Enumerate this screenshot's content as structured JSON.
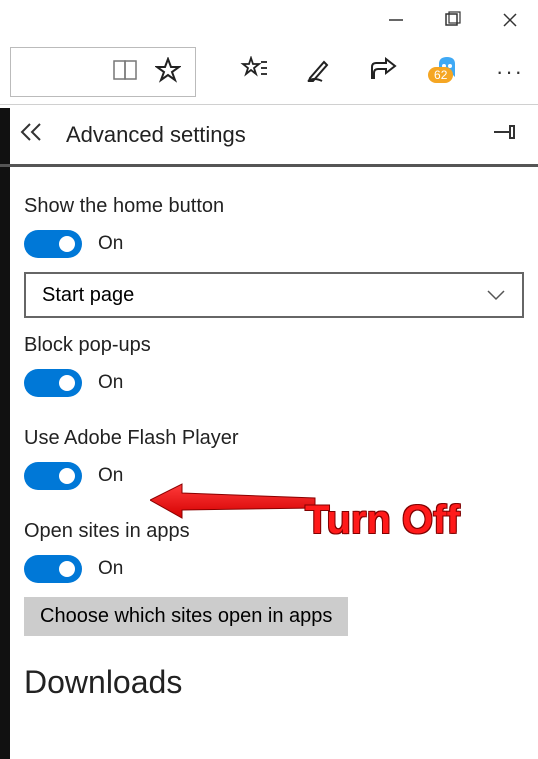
{
  "window": {
    "badge_count": "62"
  },
  "panel": {
    "title": "Advanced settings"
  },
  "settings": {
    "home_button": {
      "label": "Show the home button",
      "state": "On"
    },
    "start_page_dropdown": "Start page",
    "block_popups": {
      "label": "Block pop-ups",
      "state": "On"
    },
    "flash": {
      "label": "Use Adobe Flash Player",
      "state": "On"
    },
    "open_sites": {
      "label": "Open sites in apps",
      "state": "On"
    },
    "choose_sites_btn": "Choose which sites open in apps",
    "downloads_heading": "Downloads"
  },
  "annotation": {
    "text": "Turn Off"
  }
}
